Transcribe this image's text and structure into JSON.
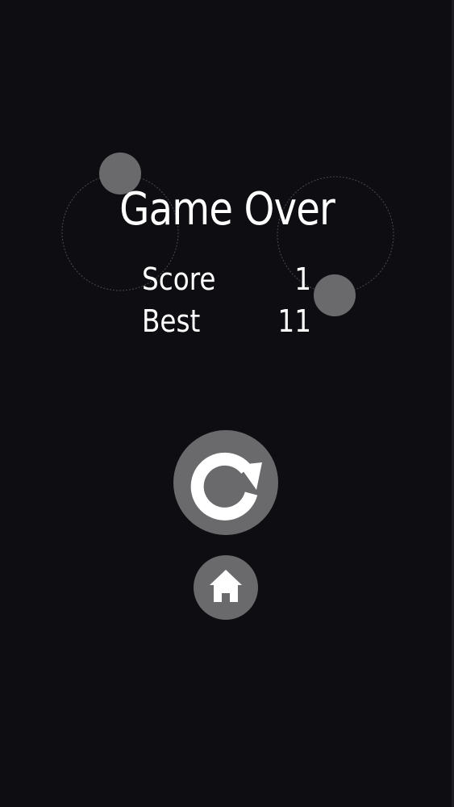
{
  "game_over": {
    "title": "Game Over",
    "score_label": "Score",
    "score_value": "1",
    "best_label": "Best",
    "best_value": "11"
  },
  "buttons": {
    "restart_icon": "restart-arrow-icon",
    "home_icon": "home-icon"
  },
  "colors": {
    "background": "#0e0d11",
    "orb": "#6a6a6c",
    "orbit_line": "#4a4a4e",
    "text": "#ffffff"
  }
}
